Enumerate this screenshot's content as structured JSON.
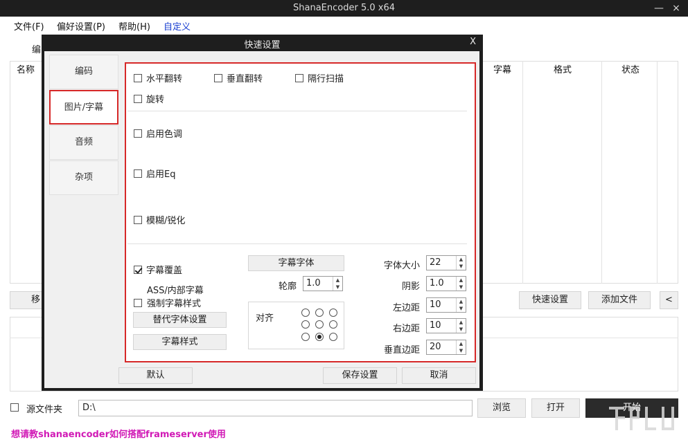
{
  "window": {
    "title": "ShanaEncoder 5.0 x64",
    "minimize": "—",
    "close": "×"
  },
  "menu": {
    "file": "文件(F)",
    "prefs": "偏好设置(P)",
    "help": "帮助(H)",
    "custom": "自定义"
  },
  "main": {
    "tab_fragment": "编",
    "columns": {
      "name": "名称",
      "subtitle": "字幕",
      "format": "格式",
      "status": "状态"
    },
    "move_fragment": "移",
    "quick_settings_btn": "快速设置",
    "add_file_btn": "添加文件",
    "collapse_btn": "<",
    "source_folder_label": "源文件夹",
    "output_path": "D:\\",
    "browse_btn": "浏览",
    "open_btn": "打开",
    "start_btn": "开始",
    "footer_link": "想请教shanaencoder如何搭配frameserver使用"
  },
  "dialog": {
    "title": "快速设置",
    "close": "X",
    "tabs": [
      "编码",
      "图片/字幕",
      "音频",
      "杂项"
    ],
    "active_tab": "图片/字幕",
    "checkboxes": {
      "hflip": "水平翻转",
      "vflip": "垂直翻转",
      "interlace": "隔行扫描",
      "rotate": "旋转",
      "color": "启用色调",
      "eq": "启用Eq",
      "blur": "模糊/锐化",
      "sub_overlay": "字幕覆盖",
      "ass_line1": "ASS/内部字幕",
      "ass_line2": "强制字幕样式"
    },
    "buttons": {
      "alt_font": "替代字体设置",
      "sub_style": "字幕样式",
      "sub_font": "字幕字体",
      "default": "默认",
      "save": "保存设置",
      "cancel": "取消"
    },
    "outline_label": "轮廓",
    "outline_value": "1.0",
    "align_label": "对齐",
    "fields": {
      "font_size": {
        "label": "字体大小",
        "value": "22"
      },
      "shadow": {
        "label": "阴影",
        "value": "1.0"
      },
      "left_margin": {
        "label": "左边距",
        "value": "10"
      },
      "right_margin": {
        "label": "右边距",
        "value": "10"
      },
      "vertical_margin": {
        "label": "垂直边距",
        "value": "20"
      }
    }
  },
  "colors": {
    "accent_red": "#d62828",
    "menu_blue": "#1a3fd1",
    "footer_magenta": "#d11ab6"
  }
}
